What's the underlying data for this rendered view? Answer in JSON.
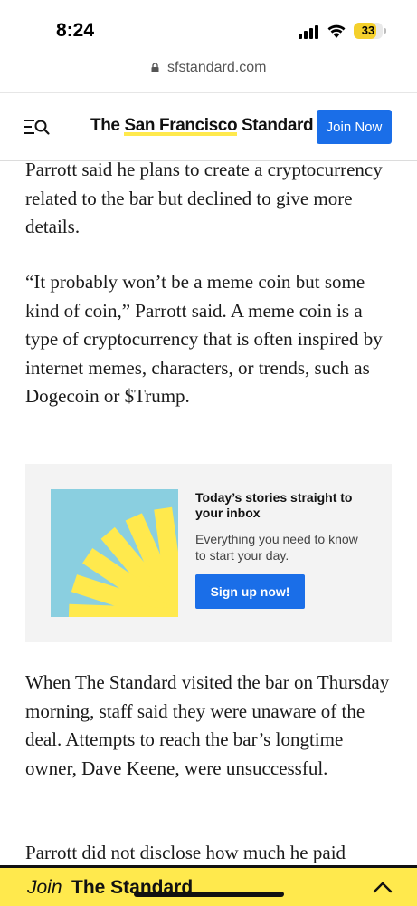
{
  "status_bar": {
    "time": "8:24",
    "battery": "33",
    "battery_level": 0.33,
    "icons": [
      "signal-icon",
      "wifi-icon",
      "battery-icon"
    ]
  },
  "browser": {
    "url": "sfstandard.com",
    "icon": "lock-icon"
  },
  "header": {
    "logo_prefix": "The ",
    "logo_highlight": "San Francisco",
    "logo_suffix": " Standard",
    "join_label": "Join Now",
    "menu_icon": "menu-search-icon",
    "accent_color": "#1a6ee8"
  },
  "article": {
    "paragraphs": [
      "Parrott said he plans to create a cryptocurrency related to the bar but declined to give more details.",
      "“It probably won’t be a meme coin but some kind of coin,” Parrott said. A meme coin is a type of cryptocurrency that is often inspired by internet memes, characters, or trends, such as Dogecoin or $Trump.",
      "When The Standard visited the bar on Thursday morning, staff said they were unaware of the deal. Attempts to reach the bar’s longtime owner, Dave Keene, were unsuccessful.",
      "Parrott did not disclose how much he paid"
    ]
  },
  "newsletter": {
    "title": "Today’s stories straight to your inbox",
    "description": "Everything you need to know to start your day.",
    "button_label": "Sign up now!",
    "art_colors": {
      "background": "#8acfe0",
      "sun": "#ffe94d"
    }
  },
  "bottom_bar": {
    "join_text": "Join",
    "brand_text": "The Standard",
    "icon": "chevron-up-icon",
    "color": "#ffe94d"
  }
}
